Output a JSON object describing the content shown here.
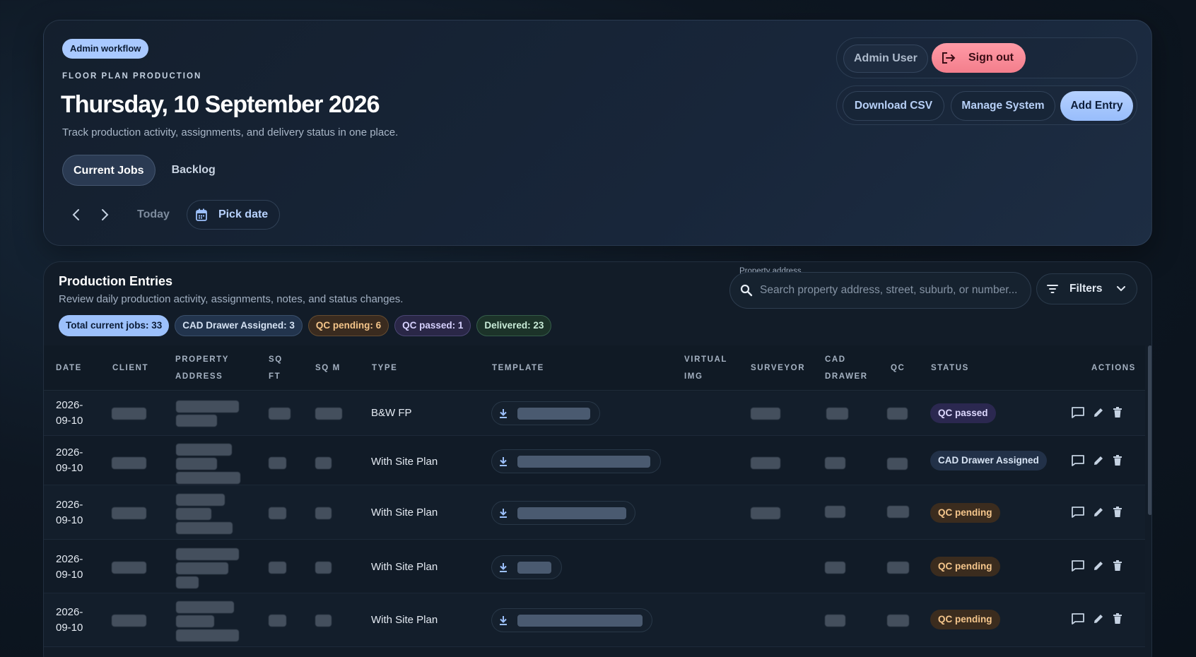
{
  "header": {
    "badge": "Admin workflow",
    "eyebrow": "FLOOR PLAN PRODUCTION",
    "title": "Thursday, 10 September 2026",
    "subtitle": "Track production activity, assignments, and delivery status in one place.",
    "tabs": [
      {
        "label": "Current Jobs",
        "active": true
      },
      {
        "label": "Backlog",
        "active": false
      }
    ],
    "today_label": "Today",
    "pick_date_label": "Pick date",
    "user_name": "Admin User",
    "sign_out_label": "Sign out",
    "download_csv_label": "Download CSV",
    "manage_system_label": "Manage System",
    "add_entry_label": "Add Entry"
  },
  "entries": {
    "title": "Production Entries",
    "subtitle": "Review daily production activity, assignments, notes, and status changes.",
    "search": {
      "label": "Property address",
      "placeholder": "Search property address, street, suburb, or number..."
    },
    "filters_label": "Filters",
    "stats": {
      "total": "Total current jobs: 33",
      "cad": "CAD Drawer Assigned: 3",
      "qc_pending": "QC pending: 6",
      "qc_passed": "QC passed: 1",
      "delivered": "Delivered: 23"
    },
    "columns": {
      "date": "DATE",
      "client": "CLIENT",
      "property_1": "PROPERTY",
      "property_2": "ADDRESS",
      "sqft_1": "SQ",
      "sqft_2": "FT",
      "sqm": "SQ M",
      "type": "TYPE",
      "template": "TEMPLATE",
      "virtual_1": "VIRTUAL",
      "virtual_2": "IMG",
      "surveyor": "SURVEYOR",
      "cad_1": "CAD",
      "cad_2": "DRAWER",
      "qc": "QC",
      "status": "STATUS",
      "actions": "ACTIONS"
    },
    "rows": [
      {
        "date_1": "2026-",
        "date_2": "09-10",
        "type": "B&W FP",
        "status": "QC passed"
      },
      {
        "date_1": "2026-",
        "date_2": "09-10",
        "type": "With Site Plan",
        "status": "CAD Drawer Assigned"
      },
      {
        "date_1": "2026-",
        "date_2": "09-10",
        "type": "With Site Plan",
        "status": "QC pending"
      },
      {
        "date_1": "2026-",
        "date_2": "09-10",
        "type": "With Site Plan",
        "status": "QC pending"
      },
      {
        "date_1": "2026-",
        "date_2": "09-10",
        "type": "With Site Plan",
        "status": "QC pending"
      }
    ]
  },
  "colors": {
    "accent": "#9cc0fb",
    "sign_out": "#f37e8c",
    "qc_pending": "#f5c68c",
    "qc_passed": "#ded9ff"
  }
}
